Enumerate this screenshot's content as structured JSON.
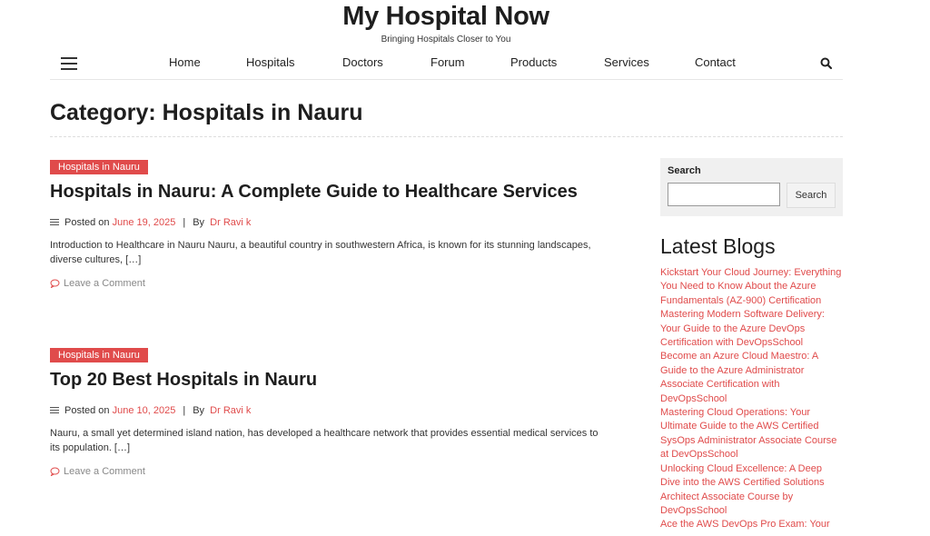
{
  "site": {
    "title": "My Hospital Now",
    "tagline": "Bringing Hospitals Closer to You"
  },
  "nav": {
    "items": [
      "Home",
      "Hospitals",
      "Doctors",
      "Forum",
      "Products",
      "Services",
      "Contact"
    ],
    "menu_icon": "hamburger-icon",
    "search_icon": "search-icon"
  },
  "page": {
    "title": "Category: Hospitals in Nauru"
  },
  "posts": [
    {
      "category": "Hospitals in Nauru",
      "title": "Hospitals in Nauru: A Complete Guide to Healthcare Services",
      "posted_on_label": "Posted on",
      "date": "June 19, 2025",
      "separator": "|",
      "by_label": "By",
      "author": "Dr Ravi k",
      "excerpt": "Introduction to Healthcare in Nauru Nauru, a beautiful country in southwestern Africa, is known for its stunning landscapes, diverse cultures, […]",
      "comment_label": "Leave a Comment"
    },
    {
      "category": "Hospitals in Nauru",
      "title": "Top 20 Best Hospitals in Nauru",
      "posted_on_label": "Posted on",
      "date": "June 10, 2025",
      "separator": "|",
      "by_label": "By",
      "author": "Dr Ravi k",
      "excerpt": "Nauru, a small yet determined island nation, has developed a healthcare network that provides essential medical services to its population. […]",
      "comment_label": "Leave a Comment"
    }
  ],
  "sidebar": {
    "search": {
      "label": "Search",
      "value": "",
      "button": "Search"
    },
    "latest_blogs": {
      "heading": "Latest Blogs",
      "items": [
        "Kickstart Your Cloud Journey: Everything You Need to Know About the Azure Fundamentals (AZ-900) Certification",
        "Mastering Modern Software Delivery: Your Guide to the Azure DevOps Certification with DevOpsSchool",
        "Become an Azure Cloud Maestro: A Guide to the Azure Administrator Associate Certification with DevOpsSchool",
        "Mastering Cloud Operations: Your Ultimate Guide to the AWS Certified SysOps Administrator Associate Course at DevOpsSchool",
        "Unlocking Cloud Excellence: A Deep Dive into the AWS Certified Solutions Architect Associate Course by DevOpsSchool",
        "Ace the AWS DevOps Pro Exam: Your"
      ]
    }
  },
  "colors": {
    "accent": "#e04b4b",
    "text": "#1e1e1e",
    "sidebar_bg": "#f0f0f0"
  }
}
